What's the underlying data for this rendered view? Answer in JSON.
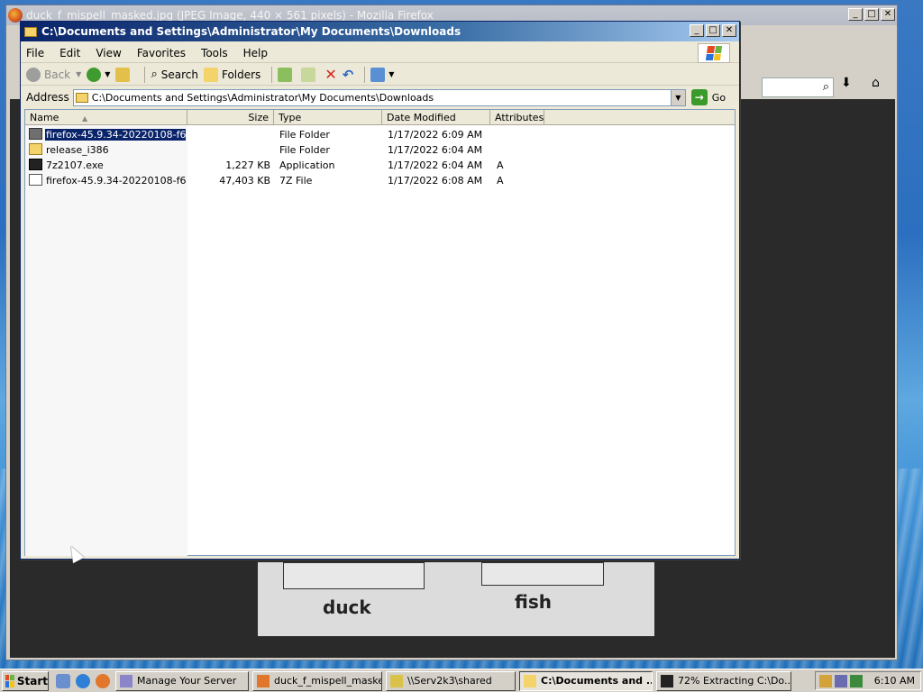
{
  "firefox": {
    "title": "duck_f_mispell_masked.jpg (JPEG Image, 440 × 561 pixels) - Mozilla Firefox",
    "image_words": [
      "duck",
      "fish"
    ]
  },
  "explorer": {
    "title": "C:\\Documents and Settings\\Administrator\\My Documents\\Downloads",
    "menu": [
      "File",
      "Edit",
      "View",
      "Favorites",
      "Tools",
      "Help"
    ],
    "toolbar": {
      "back": "Back",
      "search": "Search",
      "folders": "Folders"
    },
    "address_label": "Address",
    "address_value": "C:\\Documents and Settings\\Administrator\\My Documents\\Downloads",
    "go_label": "Go",
    "columns": [
      "Name",
      "Size",
      "Type",
      "Date Modified",
      "Attributes"
    ],
    "files": [
      {
        "name": "firefox-45.9.34-20220108-f6...",
        "size": "",
        "type": "File Folder",
        "modified": "1/17/2022 6:09 AM",
        "attributes": "",
        "icon": "folder-dark-icon",
        "selected": true
      },
      {
        "name": "release_i386",
        "size": "",
        "type": "File Folder",
        "modified": "1/17/2022 6:04 AM",
        "attributes": "",
        "icon": "folder-icon",
        "selected": false
      },
      {
        "name": "7z2107.exe",
        "size": "1,227 KB",
        "type": "Application",
        "modified": "1/17/2022 6:04 AM",
        "attributes": "A",
        "icon": "7zip-icon",
        "selected": false
      },
      {
        "name": "firefox-45.9.34-20220108-f6...",
        "size": "47,403 KB",
        "type": "7Z File",
        "modified": "1/17/2022 6:08 AM",
        "attributes": "A",
        "icon": "archive-icon",
        "selected": false
      }
    ]
  },
  "taskbar": {
    "start": "Start",
    "tasks": [
      {
        "label": "Manage Your Server",
        "active": false
      },
      {
        "label": "duck_f_mispell_maske...",
        "active": false
      },
      {
        "label": "\\\\Serv2k3\\shared",
        "active": false
      },
      {
        "label": "C:\\Documents and ...",
        "active": true
      },
      {
        "label": "72% Extracting C:\\Do...",
        "active": false
      }
    ],
    "clock": "6:10 AM"
  },
  "colors": {
    "titlebar_active": "#0a246a",
    "selection": "#0a246a",
    "window_face": "#ece9d8"
  }
}
